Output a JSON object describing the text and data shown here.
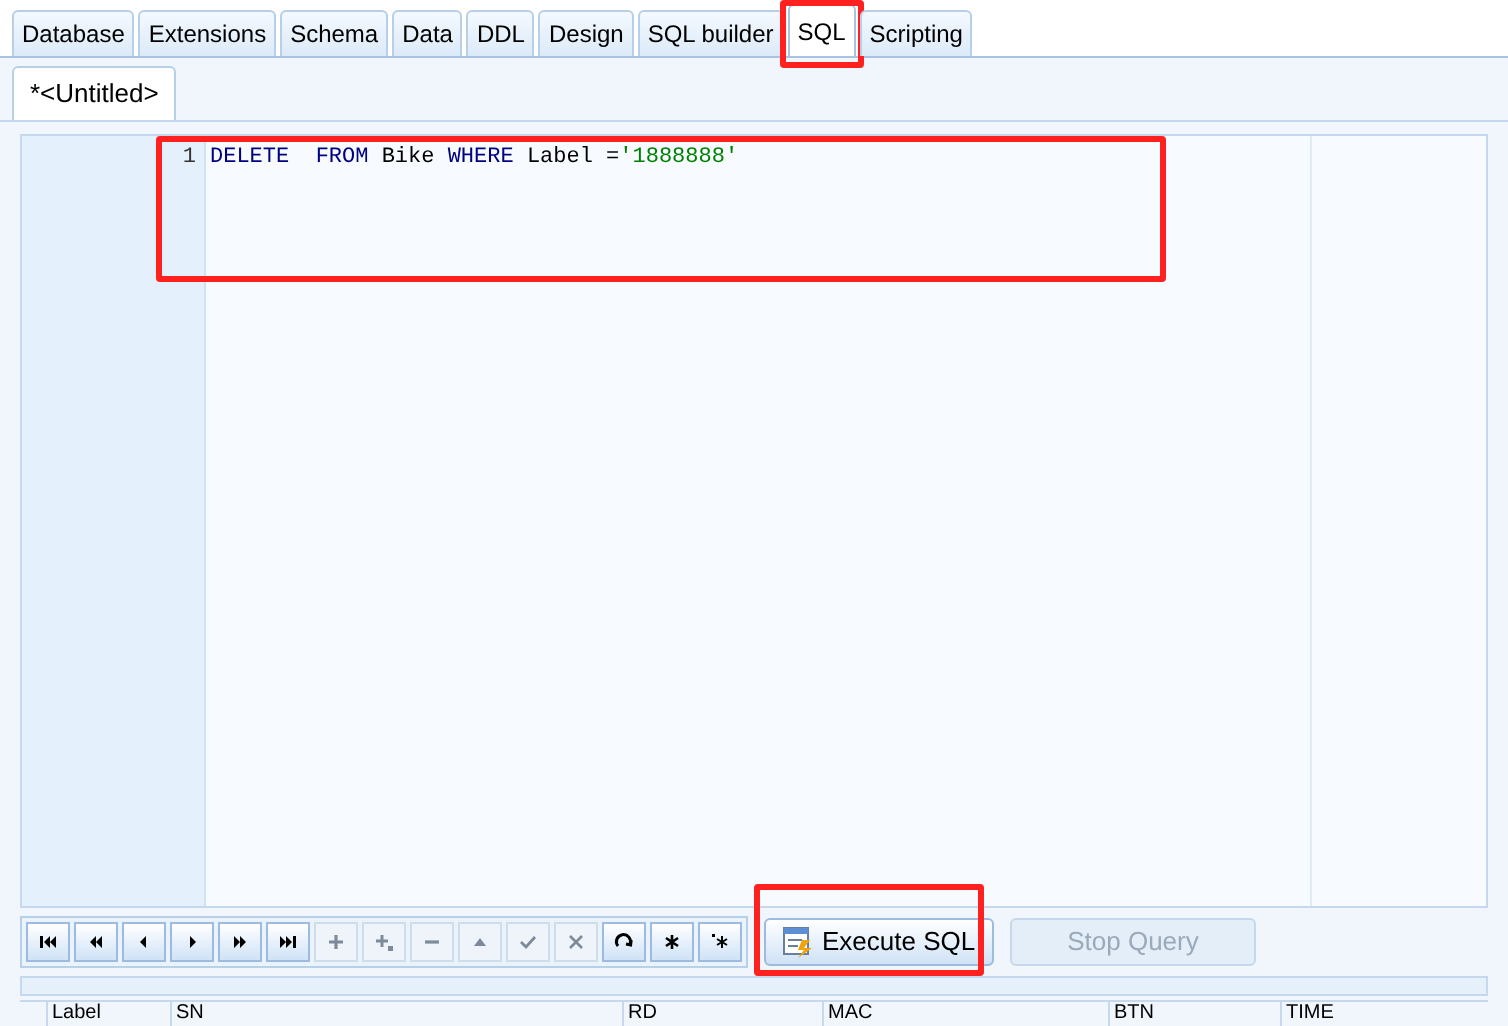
{
  "tabs": [
    {
      "label": "Database",
      "selected": false
    },
    {
      "label": "Extensions",
      "selected": false
    },
    {
      "label": "Schema",
      "selected": false
    },
    {
      "label": "Data",
      "selected": false
    },
    {
      "label": "DDL",
      "selected": false
    },
    {
      "label": "Design",
      "selected": false
    },
    {
      "label": "SQL builder",
      "selected": false
    },
    {
      "label": "SQL",
      "selected": true
    },
    {
      "label": "Scripting",
      "selected": false
    }
  ],
  "document_tabs": [
    {
      "label": "*<Untitled>",
      "selected": true
    }
  ],
  "editor": {
    "lines": [
      {
        "number": "1",
        "tokens": [
          {
            "kind": "keyword",
            "text": "DELETE  "
          },
          {
            "kind": "keyword",
            "text": "FROM"
          },
          {
            "kind": "text",
            "text": " Bike "
          },
          {
            "kind": "keyword",
            "text": "WHERE"
          },
          {
            "kind": "text",
            "text": " Label ="
          },
          {
            "kind": "string",
            "text": "'1888888'"
          }
        ]
      }
    ]
  },
  "navigator": [
    {
      "kind": "first",
      "disabled": false
    },
    {
      "kind": "prior-page",
      "disabled": false
    },
    {
      "kind": "prior",
      "disabled": false
    },
    {
      "kind": "next",
      "disabled": false
    },
    {
      "kind": "next-page",
      "disabled": false
    },
    {
      "kind": "last",
      "disabled": false
    },
    {
      "kind": "insert",
      "disabled": true
    },
    {
      "kind": "append",
      "disabled": true
    },
    {
      "kind": "delete",
      "disabled": true
    },
    {
      "kind": "edit",
      "disabled": true
    },
    {
      "kind": "post",
      "disabled": true
    },
    {
      "kind": "cancel",
      "disabled": true
    },
    {
      "kind": "refresh",
      "disabled": false
    },
    {
      "kind": "bookmark",
      "disabled": false
    },
    {
      "kind": "goto-bookmark",
      "disabled": false
    }
  ],
  "buttons": [
    {
      "label": "Execute SQL",
      "disabled": false
    },
    {
      "label": "Stop Query",
      "disabled": true
    }
  ],
  "grid": {
    "columns": [
      "Label",
      "SN",
      "RD",
      "MAC",
      "BTN",
      "TIME"
    ]
  }
}
